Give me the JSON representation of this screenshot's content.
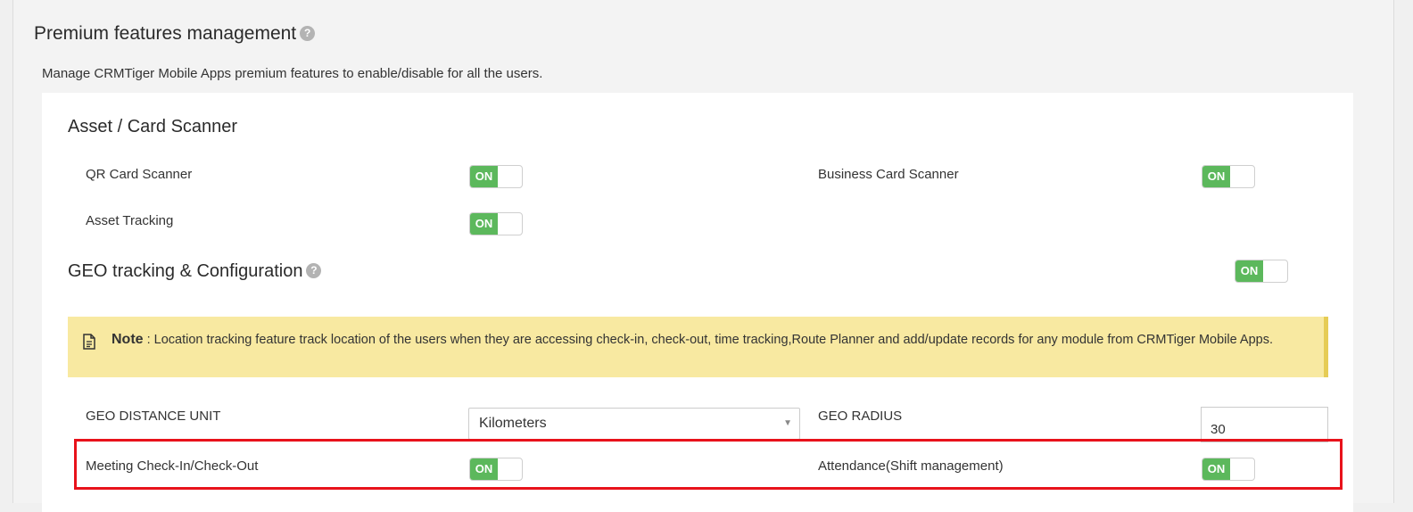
{
  "header": {
    "title": "Premium features management",
    "description": "Manage CRMTiger Mobile Apps premium features to enable/disable for all the users."
  },
  "asset_section": {
    "title": "Asset / Card Scanner",
    "qr_card_scanner": {
      "label": "QR Card Scanner",
      "state": "ON"
    },
    "business_card_scanner": {
      "label": "Business Card Scanner",
      "state": "ON"
    },
    "asset_tracking": {
      "label": "Asset Tracking",
      "state": "ON"
    }
  },
  "geo_section": {
    "title": "GEO tracking & Configuration",
    "state": "ON",
    "note": {
      "label": "Note",
      "text": " : Location tracking feature track location of the users when they are accessing check-in, check-out, time tracking,Route Planner and add/update records for any module from CRMTiger Mobile Apps."
    },
    "distance_unit": {
      "label": "GEO DISTANCE UNIT",
      "value": "Kilometers"
    },
    "radius": {
      "label": "GEO RADIUS",
      "value": "30"
    },
    "meeting_checkin": {
      "label": "Meeting Check-In/Check-Out",
      "state": "ON"
    },
    "attendance": {
      "label": "Attendance(Shift management)",
      "state": "ON"
    }
  },
  "icons": {
    "help": "question-circle-icon",
    "note": "document-icon",
    "dropdown": "caret-down-icon"
  },
  "colors": {
    "toggle_on": "#5cb85c",
    "note_background": "#f8e9a1",
    "note_border": "#e6cc55",
    "highlight": "#e8121b"
  }
}
